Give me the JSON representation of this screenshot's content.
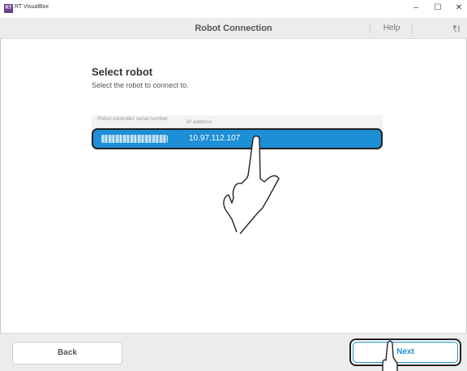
{
  "window": {
    "app_logo_text": "RT",
    "app_title": "RT VisualBox",
    "minimize": "–",
    "maximize": "☐",
    "close": "✕"
  },
  "header": {
    "title": "Robot Connection",
    "help_label": "Help",
    "settings_icon": "settings-icon"
  },
  "main": {
    "title": "Select robot",
    "subtitle": "Select the robot to connect to.",
    "table": {
      "columns": [
        "Robot controller serial number",
        "IP address"
      ],
      "rows": [
        {
          "serial": "",
          "ip": "10.97.112.107",
          "selected": true
        }
      ]
    }
  },
  "footer": {
    "back_label": "Back",
    "next_label": "Next"
  },
  "colors": {
    "accent": "#1d8fd6",
    "header_bg": "#ececec",
    "app_logo": "#6b3f8f"
  }
}
